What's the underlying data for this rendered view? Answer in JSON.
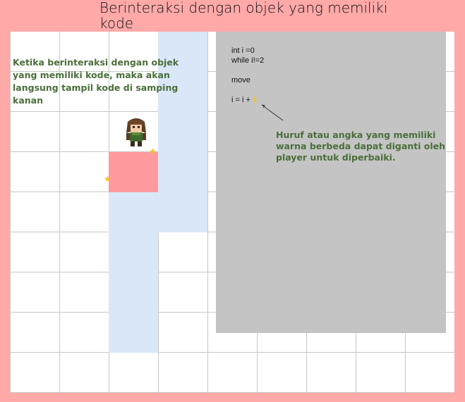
{
  "title": "Berinteraksi dengan objek yang memiliki kode",
  "left_note": "Ketika berinteraksi dengan objek yang memiliki kode, maka akan langsung tampil kode di samping kanan",
  "right_note": "Huruf atau angka yang memiliki warna berbeda dapat diganti oleh player untuk diperbaiki.",
  "code": {
    "line1": "int i =0",
    "line2": "while i!=2",
    "line3": "move",
    "line4_prefix": "i = i + ",
    "line4_editable": "1"
  },
  "colors": {
    "background": "#ffa9a9",
    "path": "#d9e7f9",
    "code_tile": "#ff9a9e",
    "code_panel": "#c4c4c4",
    "note_text": "#4a6f3a",
    "editable_value": "#f4c51c"
  },
  "icons": {
    "star": "star-icon",
    "hero": "player-character-sprite",
    "arrow": "pointer-arrow"
  }
}
